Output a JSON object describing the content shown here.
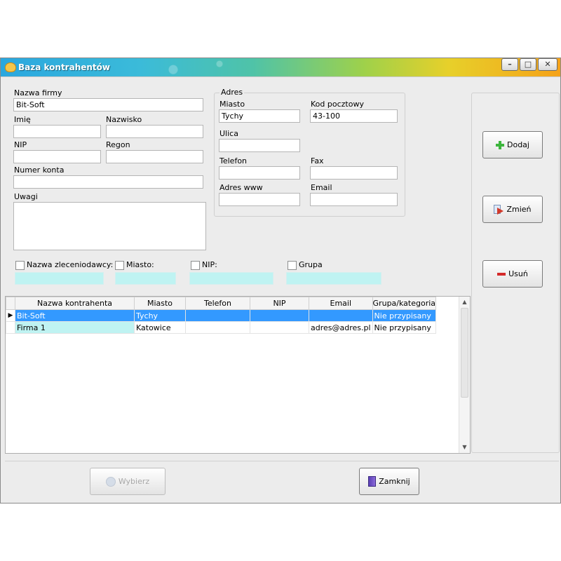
{
  "window": {
    "title": "Baza kontrahentów"
  },
  "form": {
    "company_name_label": "Nazwa firmy",
    "company_name_value": "Bit-Soft",
    "first_name_label": "Imię",
    "first_name_value": "",
    "last_name_label": "Nazwisko",
    "last_name_value": "",
    "nip_label": "NIP",
    "nip_value": "",
    "regon_label": "Regon",
    "regon_value": "",
    "account_label": "Numer konta",
    "account_value": "",
    "notes_label": "Uwagi",
    "notes_value": ""
  },
  "address": {
    "group_label": "Adres",
    "city_label": "Miasto",
    "city_value": "Tychy",
    "postal_label": "Kod pocztowy",
    "postal_value": "43-100",
    "street_label": "Ulica",
    "street_value": "",
    "phone_label": "Telefon",
    "phone_value": "",
    "fax_label": "Fax",
    "fax_value": "",
    "www_label": "Adres www",
    "www_value": "",
    "email_label": "Email",
    "email_value": ""
  },
  "actions": {
    "add": "Dodaj",
    "edit": "Zmień",
    "delete": "Usuń"
  },
  "filters": {
    "client_name": "Nazwa zleceniodawcy:",
    "city": "Miasto:",
    "nip": "NIP:",
    "group": "Grupa"
  },
  "grid": {
    "columns": [
      "Nazwa kontrahenta",
      "Miasto",
      "Telefon",
      "NIP",
      "Email",
      "Grupa/kategoria"
    ],
    "rows": [
      [
        "Bit-Soft",
        "Tychy",
        "",
        "",
        "",
        "Nie przypisany"
      ],
      [
        "Firma 1",
        "Katowice",
        "",
        "",
        "adres@adres.pl",
        "Nie przypisany"
      ]
    ]
  },
  "footer": {
    "select": "Wybierz",
    "close": "Zamknij"
  },
  "colors": {
    "selection": "#3399ff",
    "filter_bg": "#bff3f2"
  }
}
